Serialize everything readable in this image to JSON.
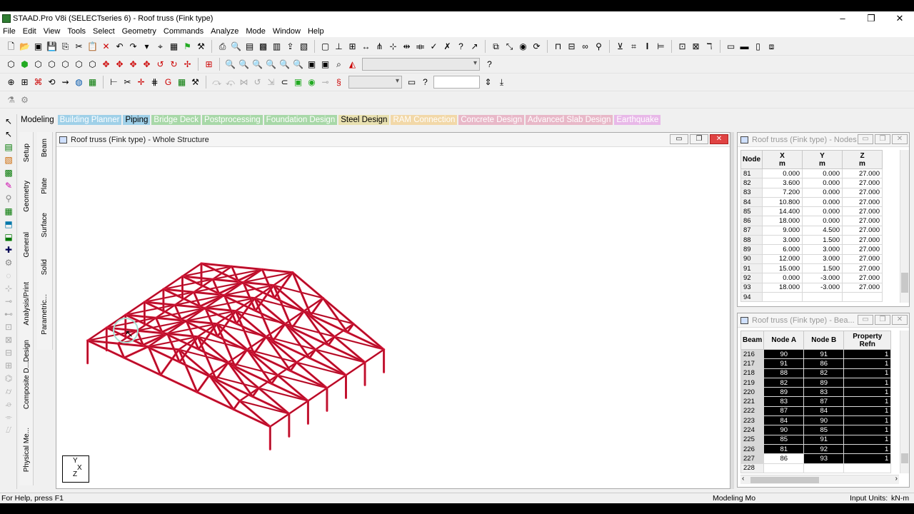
{
  "app": {
    "title": "STAAD.Pro V8i (SELECTseries 6) - Roof truss (Fink type)",
    "window_controls": [
      "–",
      "❐",
      "✕"
    ]
  },
  "menu": [
    "File",
    "Edit",
    "View",
    "Tools",
    "Select",
    "Geometry",
    "Commands",
    "Analyze",
    "Mode",
    "Window",
    "Help"
  ],
  "workflow_tabs": [
    {
      "label": "Modeling",
      "bg": "",
      "fg": "#000000"
    },
    {
      "label": "Building Planner",
      "bg": "#9fd0e8",
      "fg": "#ffffff"
    },
    {
      "label": "Piping",
      "bg": "#9fd0e8",
      "fg": "#000000"
    },
    {
      "label": "Bridge Deck",
      "bg": "#a8d8a8",
      "fg": "#ffffff"
    },
    {
      "label": "Postprocessing",
      "bg": "#a8d8a8",
      "fg": "#ffffff"
    },
    {
      "label": "Foundation Design",
      "bg": "#a8d8a8",
      "fg": "#ffffff"
    },
    {
      "label": "Steel Design",
      "bg": "#e8e0b0",
      "fg": "#000000"
    },
    {
      "label": "RAM Connection",
      "bg": "#f2d8a8",
      "fg": "#ffffff"
    },
    {
      "label": "Concrete Design",
      "bg": "#e8b8c8",
      "fg": "#ffffff"
    },
    {
      "label": "Advanced Slab Design",
      "bg": "#e8b8c8",
      "fg": "#ffffff"
    },
    {
      "label": "Earthquake",
      "bg": "#e8b8e8",
      "fg": "#ffffff"
    }
  ],
  "page_tabs_1": [
    "Setup",
    "Geometry",
    "General",
    "Analysis/Print",
    "Design"
  ],
  "page_tabs_1_more": [
    "Composite D...",
    "Physical Me..."
  ],
  "page_tabs_2": [
    "Beam",
    "Plate",
    "Surface",
    "Solid",
    "Parametric..."
  ],
  "structure_window": {
    "title": "Roof truss (Fink type) - Whole Structure",
    "member_color": "#d8193a",
    "axis_labels": {
      "y": "Y",
      "z": "Z",
      "x": "X"
    }
  },
  "nodes_window": {
    "title": "Roof truss (Fink type) - Nodes",
    "columns": [
      "Node",
      "X\nm",
      "Y\nm",
      "Z\nm"
    ],
    "rows": [
      [
        "81",
        "0.000",
        "0.000",
        "27.000"
      ],
      [
        "82",
        "3.600",
        "0.000",
        "27.000"
      ],
      [
        "83",
        "7.200",
        "0.000",
        "27.000"
      ],
      [
        "84",
        "10.800",
        "0.000",
        "27.000"
      ],
      [
        "85",
        "14.400",
        "0.000",
        "27.000"
      ],
      [
        "86",
        "18.000",
        "0.000",
        "27.000"
      ],
      [
        "87",
        "9.000",
        "4.500",
        "27.000"
      ],
      [
        "88",
        "3.000",
        "1.500",
        "27.000"
      ],
      [
        "89",
        "6.000",
        "3.000",
        "27.000"
      ],
      [
        "90",
        "12.000",
        "3.000",
        "27.000"
      ],
      [
        "91",
        "15.000",
        "1.500",
        "27.000"
      ],
      [
        "92",
        "0.000",
        "-3.000",
        "27.000"
      ],
      [
        "93",
        "18.000",
        "-3.000",
        "27.000"
      ],
      [
        "94",
        "",
        "",
        ""
      ]
    ]
  },
  "beams_window": {
    "title": "Roof truss (Fink type) - Bea...",
    "columns": [
      "Beam",
      "Node A",
      "Node B",
      "Property Refn"
    ],
    "rows": [
      [
        "216",
        "90",
        "91",
        "1"
      ],
      [
        "217",
        "91",
        "86",
        "1"
      ],
      [
        "218",
        "88",
        "82",
        "1"
      ],
      [
        "219",
        "82",
        "89",
        "1"
      ],
      [
        "220",
        "89",
        "83",
        "1"
      ],
      [
        "221",
        "83",
        "87",
        "1"
      ],
      [
        "222",
        "87",
        "84",
        "1"
      ],
      [
        "223",
        "84",
        "90",
        "1"
      ],
      [
        "224",
        "90",
        "85",
        "1"
      ],
      [
        "225",
        "85",
        "91",
        "1"
      ],
      [
        "226",
        "81",
        "92",
        "1"
      ],
      [
        "227",
        "86",
        "93",
        "1"
      ],
      [
        "228",
        "",
        "",
        ""
      ]
    ]
  },
  "status": {
    "help": "For Help, press F1",
    "mode": "Modeling Mo",
    "units_label": "Input Units:",
    "units_value": "kN-m"
  }
}
